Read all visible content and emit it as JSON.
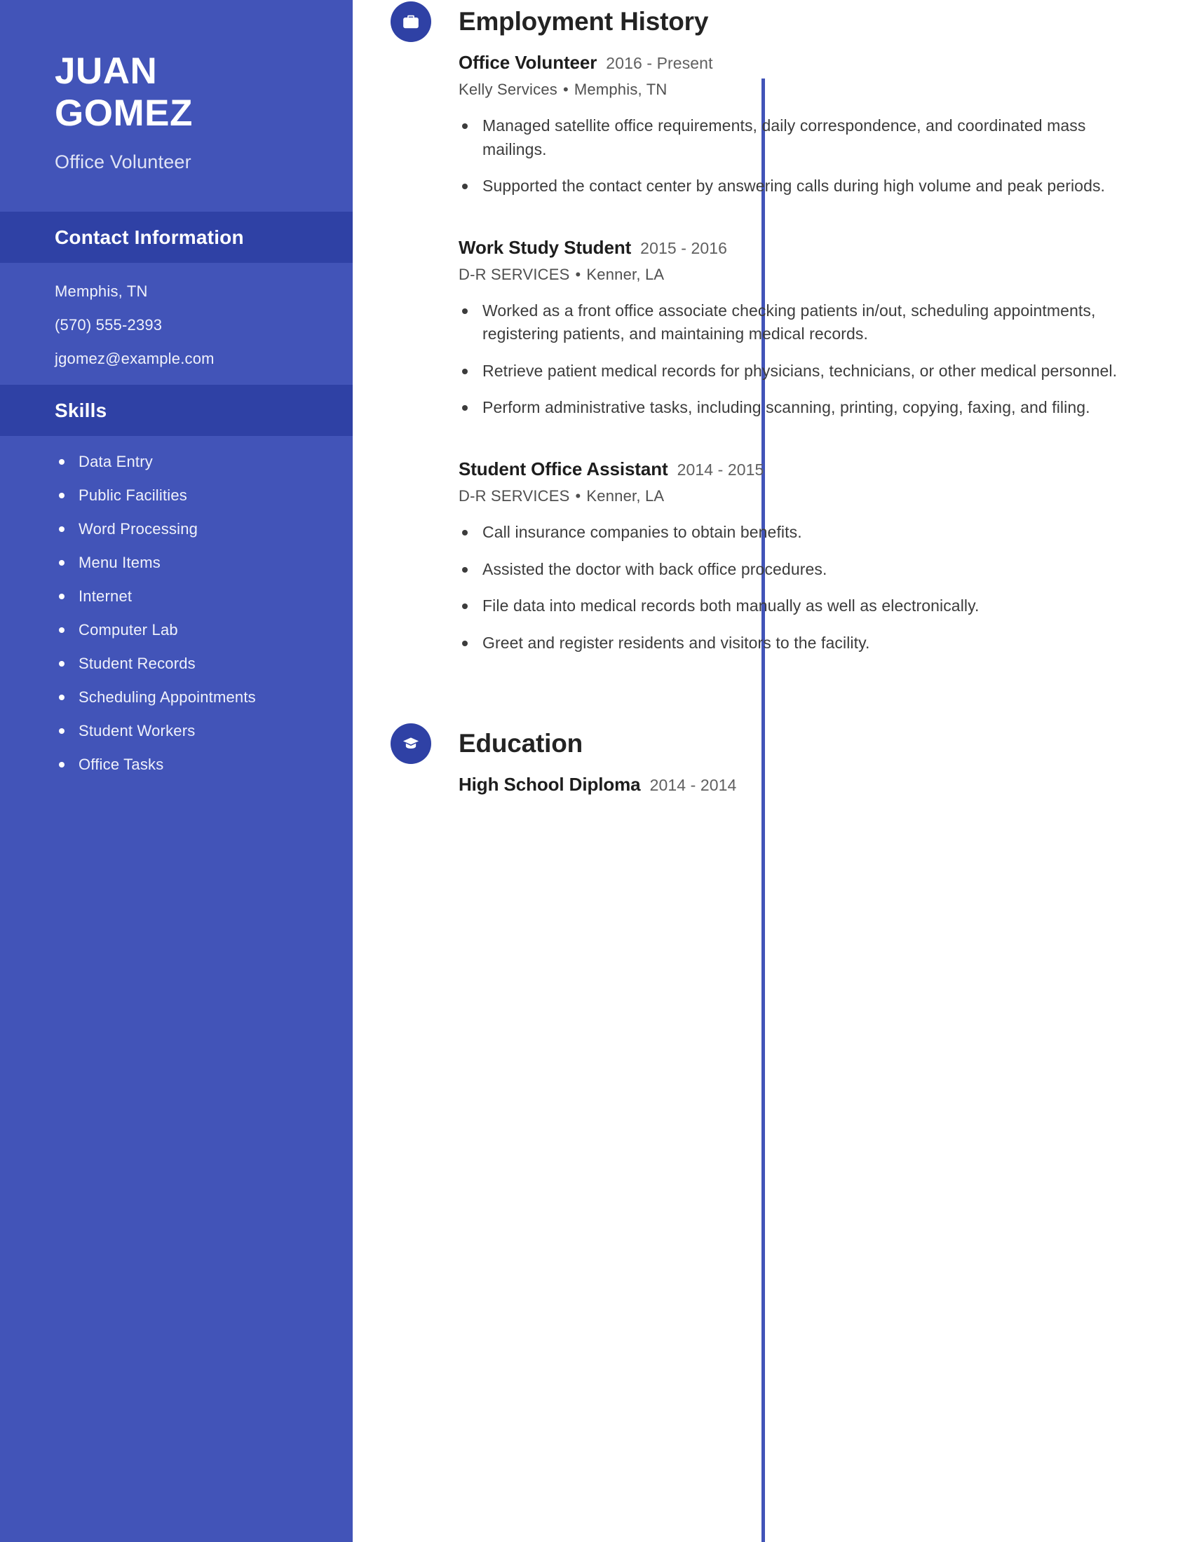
{
  "theme": {
    "sidebar_bg": "#4254b8",
    "band_bg": "#2f41a5",
    "accent": "#2f41a5",
    "page_bg": "#ffffff",
    "body_text": "#3c3c3c"
  },
  "sidebar": {
    "first_name": "JUAN",
    "last_name": "GOMEZ",
    "headline": "Office Volunteer",
    "contact": {
      "heading": "Contact Information",
      "items": [
        "Memphis, TN",
        "(570) 555-2393",
        "jgomez@example.com"
      ]
    },
    "skills": {
      "heading": "Skills",
      "items": [
        "Data Entry",
        "Public Facilities",
        "Word Processing",
        "Menu Items",
        "Internet",
        "Computer Lab",
        "Student Records",
        "Scheduling Appointments",
        "Student Workers",
        "Office Tasks"
      ]
    }
  },
  "main": {
    "employment": {
      "icon": "briefcase-icon",
      "heading": "Employment History",
      "entries": [
        {
          "title": "Office Volunteer",
          "dates": "2016 - Present",
          "company": "Kelly Services",
          "location": "Memphis, TN",
          "separator": "•",
          "bullets": [
            "Managed satellite office requirements, daily correspondence, and coordinated mass mailings.",
            "Supported the contact center by answering calls during high volume and peak periods."
          ]
        },
        {
          "title": "Work Study Student",
          "dates": "2015 - 2016",
          "company": "D-R SERVICES",
          "location": "Kenner, LA",
          "separator": "•",
          "bullets": [
            "Worked as a front office associate checking patients in/out, scheduling appointments, registering patients, and maintaining medical records.",
            "Retrieve patient medical records for physicians, technicians, or other medical personnel.",
            "Perform administrative tasks, including scanning, printing, copying, faxing, and filing."
          ]
        },
        {
          "title": "Student Office Assistant",
          "dates": "2014 - 2015",
          "company": "D-R SERVICES",
          "location": "Kenner, LA",
          "separator": "•",
          "bullets": [
            "Call insurance companies to obtain benefits.",
            "Assisted the doctor with back office procedures.",
            "File data into medical records both manually as well as electronically.",
            "Greet and register residents and visitors to the facility."
          ]
        }
      ]
    },
    "education": {
      "icon": "graduation-cap-icon",
      "heading": "Education",
      "entries": [
        {
          "title": "High School Diploma",
          "dates": "2014 - 2014"
        }
      ]
    }
  }
}
